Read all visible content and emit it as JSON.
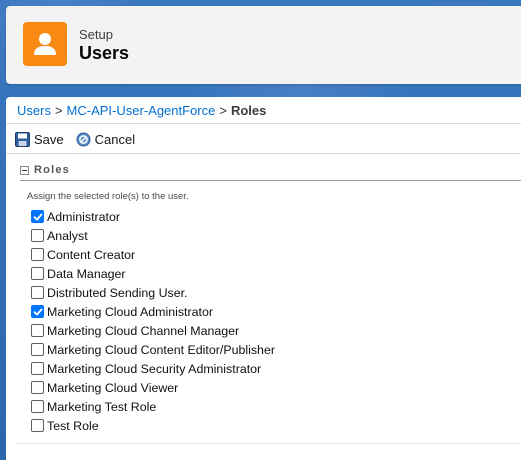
{
  "header": {
    "eyebrow": "Setup",
    "title": "Users",
    "icon": "user-icon",
    "icon_color": "#f88a14"
  },
  "breadcrumb": {
    "items": [
      "Users",
      "MC-API-User-AgentForce"
    ],
    "separator": ">",
    "current": "Roles",
    "link_color": "#0070d2"
  },
  "toolbar": {
    "save_label": "Save",
    "cancel_label": "Cancel"
  },
  "roles_section": {
    "title": "Roles",
    "instructions": "Assign the selected role(s) to the user.",
    "roles": [
      {
        "label": "Administrator",
        "checked": true
      },
      {
        "label": "Analyst",
        "checked": false
      },
      {
        "label": "Content Creator",
        "checked": false
      },
      {
        "label": "Data Manager",
        "checked": false
      },
      {
        "label": "Distributed Sending User.",
        "checked": false
      },
      {
        "label": "Marketing Cloud Administrator",
        "checked": true
      },
      {
        "label": "Marketing Cloud Channel Manager",
        "checked": false
      },
      {
        "label": "Marketing Cloud Content Editor/Publisher",
        "checked": false
      },
      {
        "label": "Marketing Cloud Security Administrator",
        "checked": false
      },
      {
        "label": "Marketing Cloud Viewer",
        "checked": false
      },
      {
        "label": "Marketing Test Role",
        "checked": false
      },
      {
        "label": "Test Role",
        "checked": false
      }
    ],
    "checked_color": "#0075ff"
  }
}
